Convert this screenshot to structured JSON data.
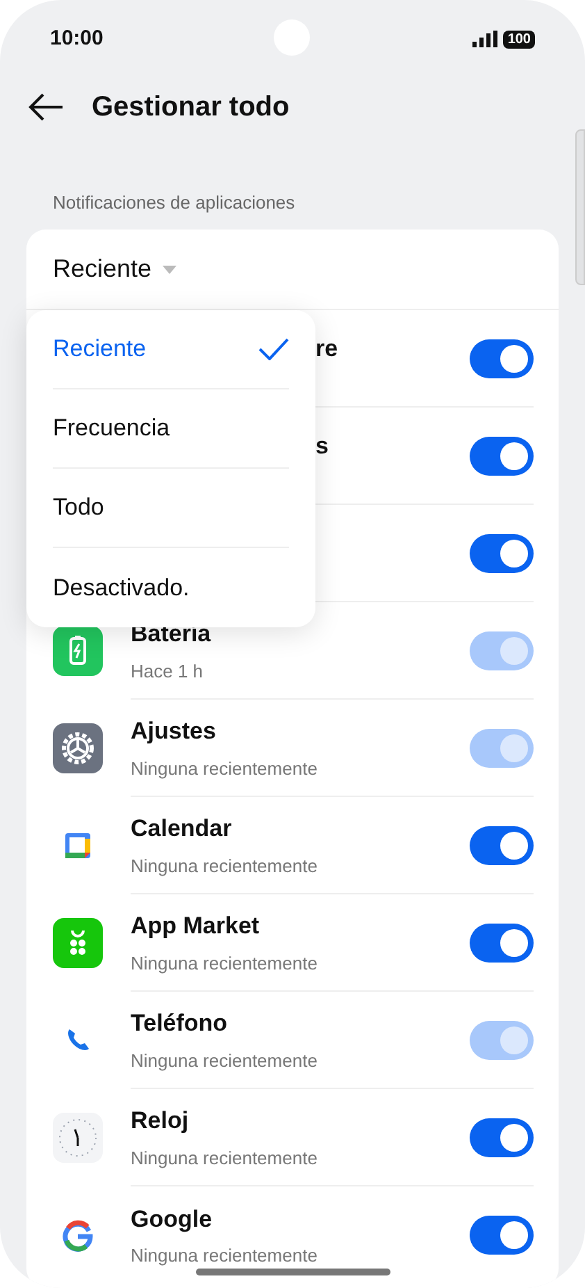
{
  "status_bar": {
    "time": "10:00",
    "battery": "100"
  },
  "header": {
    "title": "Gestionar todo"
  },
  "section": {
    "label": "Notificaciones de aplicaciones"
  },
  "sort": {
    "value": "Reciente"
  },
  "apps": [
    {
      "kind": "covered",
      "name": "re",
      "on": true,
      "disabled": false
    },
    {
      "kind": "covered",
      "name": "s",
      "on": true,
      "disabled": false
    },
    {
      "kind": "covered",
      "on": true,
      "disabled": false
    },
    {
      "kind": "app",
      "name": "Batería",
      "subtitle": "Hace 1 h",
      "on": true,
      "disabled": true
    },
    {
      "kind": "app",
      "name": "Ajustes",
      "subtitle": "Ninguna recientemente",
      "on": true,
      "disabled": true
    },
    {
      "kind": "app",
      "name": "Calendar",
      "subtitle": "Ninguna recientemente",
      "on": true,
      "disabled": false
    },
    {
      "kind": "app",
      "name": "App Market",
      "subtitle": "Ninguna recientemente",
      "on": true,
      "disabled": false
    },
    {
      "kind": "app",
      "name": "Teléfono",
      "subtitle": "Ninguna recientemente",
      "on": true,
      "disabled": true
    },
    {
      "kind": "app",
      "name": "Reloj",
      "subtitle": "Ninguna recientemente",
      "on": true,
      "disabled": false
    },
    {
      "kind": "app",
      "name": "Google",
      "subtitle": "Ninguna recientemente",
      "on": true,
      "disabled": false
    }
  ],
  "menu": {
    "options": [
      {
        "label": "Reciente",
        "selected": true
      },
      {
        "label": "Frecuencia",
        "selected": false
      },
      {
        "label": "Todo",
        "selected": false
      },
      {
        "label": "Desactivado.",
        "selected": false
      }
    ]
  }
}
